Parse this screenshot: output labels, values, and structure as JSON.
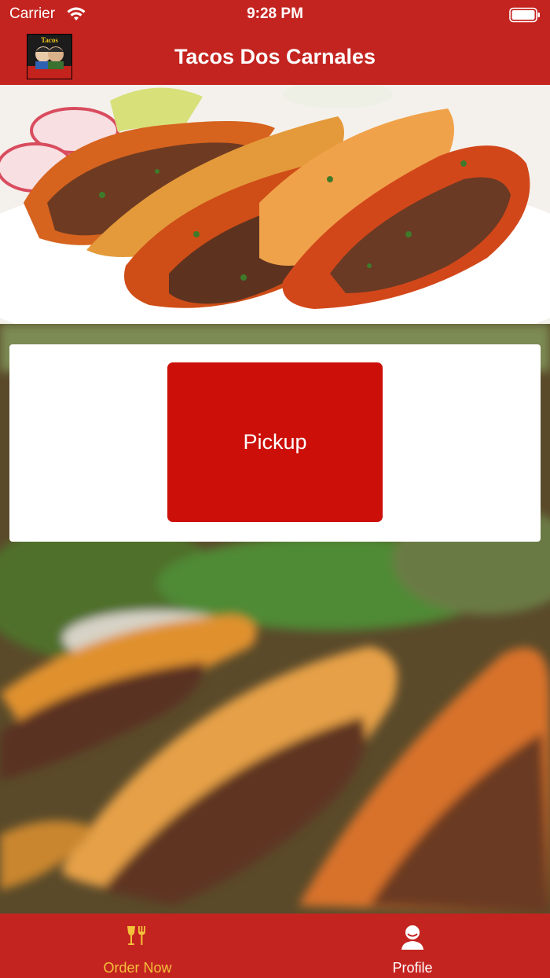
{
  "status_bar": {
    "carrier": "Carrier",
    "time": "9:28 PM"
  },
  "navbar": {
    "title": "Tacos Dos Carnales",
    "logo_text": "Tacos"
  },
  "main": {
    "pickup_label": "Pickup"
  },
  "tabbar": {
    "items": [
      {
        "label": "Order Now",
        "icon": "utensils-icon",
        "active": true
      },
      {
        "label": "Profile",
        "icon": "person-icon",
        "active": false
      }
    ]
  },
  "colors": {
    "brand_red": "#c42420",
    "button_red": "#cc0f09",
    "active_tab": "#f3c13a"
  }
}
